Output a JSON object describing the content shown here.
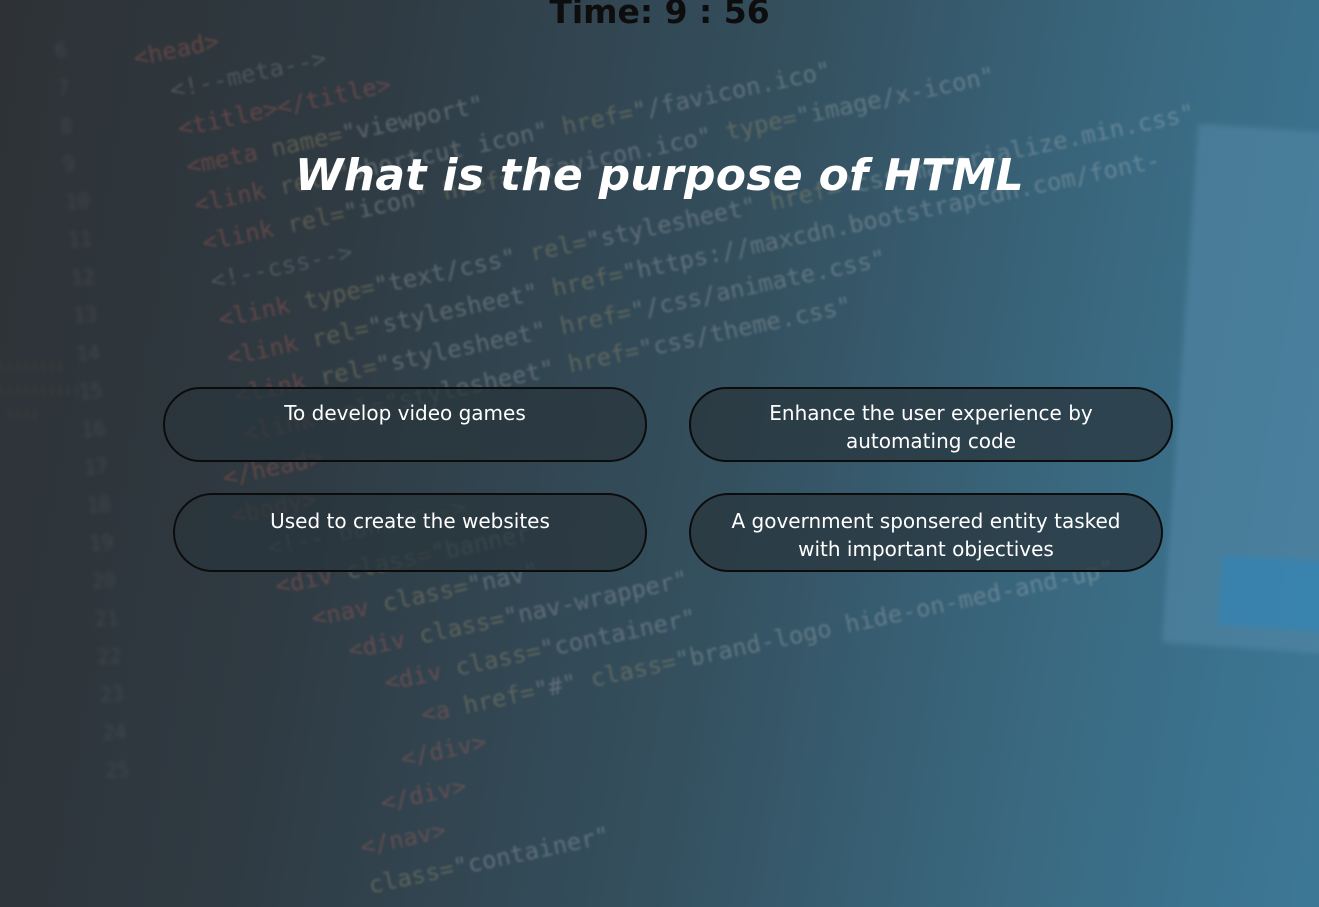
{
  "timer": {
    "text": "Time: 9 : 56"
  },
  "question": {
    "text": "What is the purpose of HTML"
  },
  "answers": [
    {
      "label": "To develop video games"
    },
    {
      "label": "Enhance the user experience by automating code"
    },
    {
      "label": "Used to create the websites"
    },
    {
      "label": "A government sponsered entity tasked with important objectives"
    }
  ],
  "colors": {
    "question_text": "#ffffff",
    "timer_text": "#0d0d0d",
    "answer_border": "#0c0c0c",
    "answer_text": "#ffffff"
  }
}
